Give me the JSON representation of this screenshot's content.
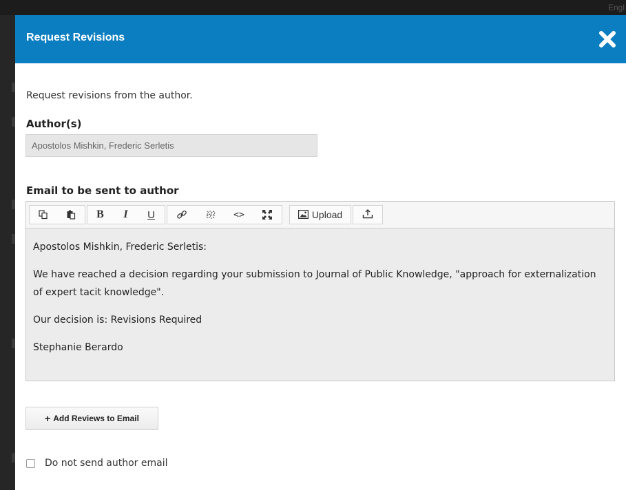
{
  "background": {
    "lang_label": "Engl"
  },
  "modal": {
    "title": "Request Revisions",
    "intro": "Request revisions from the author.",
    "authors_label": "Author(s)",
    "authors_value": "Apostolos Mishkin, Frederic Serletis",
    "email_label": "Email to be sent to author",
    "toolbar": {
      "upload_label": "Upload",
      "buttons": [
        "copy-icon",
        "paste-icon",
        "bold-icon",
        "italic-icon",
        "underline-icon",
        "link-icon",
        "unlink-icon",
        "code-icon",
        "fullscreen-icon",
        "image-icon",
        "insert-icon"
      ]
    },
    "email_body": {
      "greeting": "Apostolos Mishkin, Frederic Serletis:",
      "paragraph1": "We have reached a decision regarding your submission to Journal of Public Knowledge, \"approach for externalization of expert tacit knowledge\".",
      "paragraph2": "Our decision is: Revisions Required",
      "signature": "Stephanie Berardo"
    },
    "add_reviews_label": "Add Reviews to Email",
    "no_email_label": "Do not send author email",
    "no_email_checked": false
  },
  "colors": {
    "header": "#0a7ec0",
    "accent": "#0a7ec0"
  }
}
